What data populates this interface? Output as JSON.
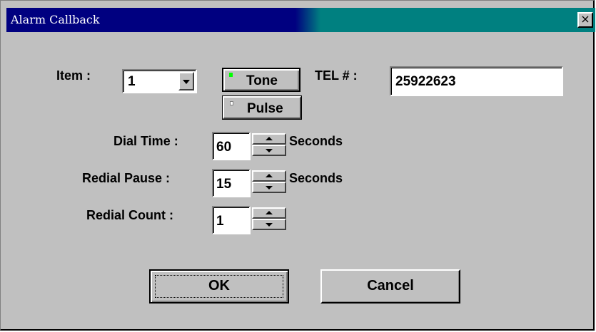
{
  "window": {
    "title": "Alarm Callback",
    "close_glyph": "×"
  },
  "item": {
    "label": "Item :",
    "value": "1"
  },
  "dial_mode": {
    "tone_label": "Tone",
    "pulse_label": "Pulse",
    "selected": "Tone",
    "led_on_color": "#00ff00",
    "led_off_color": "#ffffff"
  },
  "tel": {
    "label": "TEL # :",
    "value": "25922623"
  },
  "dial_time": {
    "label": "Dial Time :",
    "value": "60",
    "unit": "Seconds"
  },
  "redial_pause": {
    "label": "Redial Pause :",
    "value": "15",
    "unit": "Seconds"
  },
  "redial_count": {
    "label": "Redial Count :",
    "value": "1"
  },
  "buttons": {
    "ok": "OK",
    "cancel": "Cancel"
  },
  "colors": {
    "title_bar_left": "#000080",
    "title_bar_right": "#008080",
    "face": "#c0c0c0"
  }
}
